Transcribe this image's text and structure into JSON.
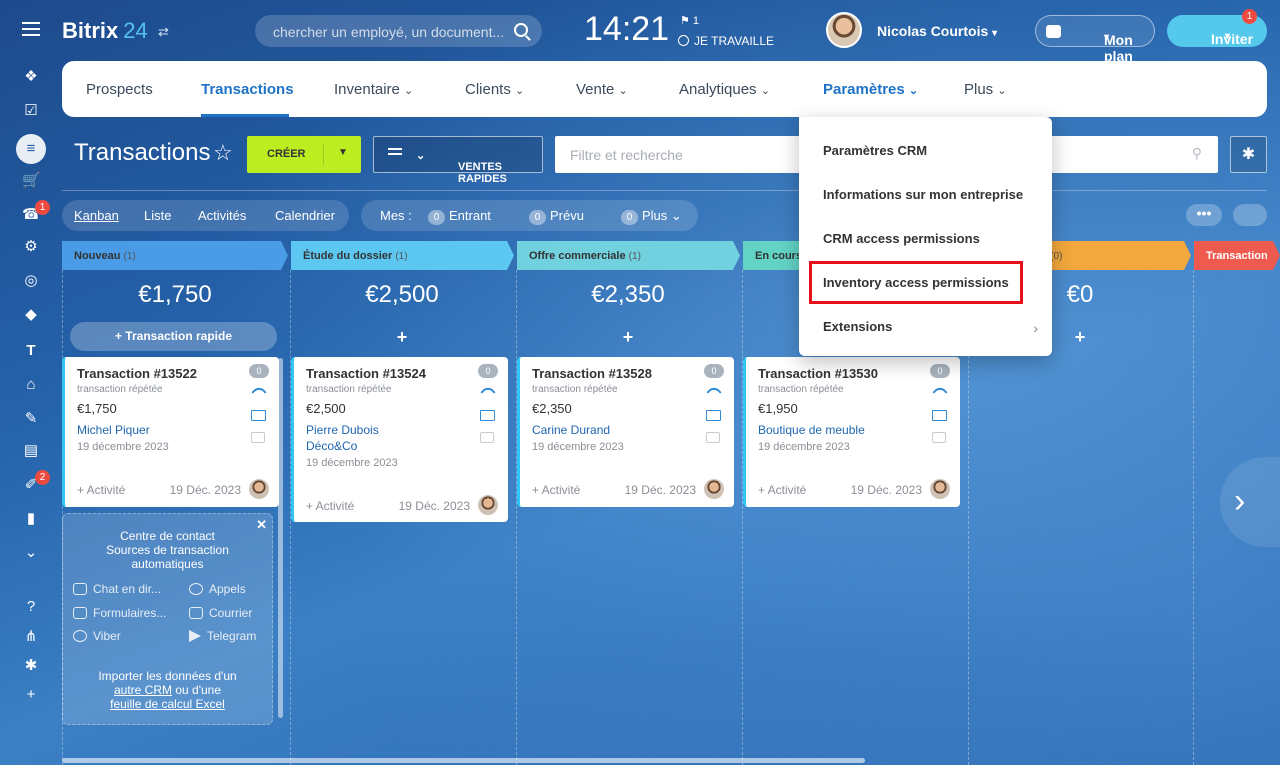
{
  "app": {
    "logo_name": "Bitrix",
    "logo_num": "24"
  },
  "search": {
    "placeholder": "chercher un employé, un document..."
  },
  "clock": {
    "time": "14:21",
    "flag_count": "1",
    "status": "JE TRAVAILLE"
  },
  "user": {
    "name": "Nicolas Courtois"
  },
  "plan": {
    "label": "Mon plan"
  },
  "invite": {
    "label": "Inviter",
    "badge": "1"
  },
  "sidebar": {
    "badges": [
      "1",
      "2"
    ]
  },
  "tabs": [
    {
      "label": "Prospects"
    },
    {
      "label": "Transactions",
      "active": true
    },
    {
      "label": "Inventaire"
    },
    {
      "label": "Clients"
    },
    {
      "label": "Vente"
    },
    {
      "label": "Analytiques"
    },
    {
      "label": "Paramètres",
      "open": true
    },
    {
      "label": "Plus"
    }
  ],
  "toolbar": {
    "title": "Transactions",
    "create": "CRÉER",
    "preset": "VENTES RAPIDES",
    "filter_placeholder": "Filtre et recherche"
  },
  "views": [
    "Kanban",
    "Liste",
    "Activités",
    "Calendrier"
  ],
  "mes": {
    "label": "Mes :",
    "items": [
      {
        "count": "0",
        "label": "Entrant"
      },
      {
        "count": "0",
        "label": "Prévu"
      },
      {
        "count": "0",
        "label": "Plus"
      }
    ]
  },
  "columns": [
    {
      "name": "Nouveau",
      "count": "(1)",
      "amount": "€1,750",
      "color": "#4a9ce6"
    },
    {
      "name": "Étude du dossier",
      "count": "(1)",
      "amount": "€2,500",
      "color": "#5cc7f0"
    },
    {
      "name": "Offre commerciale",
      "count": "(1)",
      "amount": "€2,350",
      "color": "#71d1de"
    },
    {
      "name": "En cours",
      "count": "",
      "amount": "",
      "color": "#62d3c5"
    },
    {
      "name": "e",
      "count": "(0)",
      "amount": "€0",
      "color": "#f2a83c"
    },
    {
      "name": "Transaction",
      "count": "",
      "amount": "",
      "color": "#ef5a4f"
    }
  ],
  "quick_add": "+ Transaction rapide",
  "cards": [
    {
      "title": "Transaction #13522",
      "sub": "transaction répétée",
      "price": "€1,750",
      "contact": "Michel Piquer",
      "date": "19 décembre 2023",
      "activity": "+ Activité",
      "short_date": "19 Déc. 2023",
      "count": "0"
    },
    {
      "title": "Transaction #13524",
      "sub": "transaction répétée",
      "price": "€2,500",
      "contact": "Pierre Dubois",
      "contact2": "Déco&Co",
      "date": "19 décembre 2023",
      "activity": "+ Activité",
      "short_date": "19 Déc. 2023",
      "count": "0"
    },
    {
      "title": "Transaction #13528",
      "sub": "transaction répétée",
      "price": "€2,350",
      "contact": "Carine Durand",
      "date": "19 décembre 2023",
      "activity": "+ Activité",
      "short_date": "19 Déc. 2023",
      "count": "0"
    },
    {
      "title": "Transaction #13530",
      "sub": "transaction répétée",
      "price": "€1,950",
      "contact": "Boutique de meuble",
      "date": "19 décembre 2023",
      "activity": "+ Activité",
      "short_date": "19 Déc. 2023",
      "count": "0"
    }
  ],
  "contact_center": {
    "title": "Centre de contact",
    "subtitle1": "Sources de transaction",
    "subtitle2": "automatiques",
    "items": [
      "Chat en dir...",
      "Appels",
      "Formulaires...",
      "Courrier",
      "Viber",
      "Telegram"
    ],
    "import1": "Importer les données d'un",
    "import_link1": "autre CRM",
    "import_mid": "ou d'une",
    "import_link2": "feuille de calcul Excel"
  },
  "dropdown": {
    "items": [
      "Paramètres CRM",
      "Informations sur mon entreprise",
      "CRM access permissions",
      "Inventory access permissions",
      "Extensions"
    ]
  }
}
